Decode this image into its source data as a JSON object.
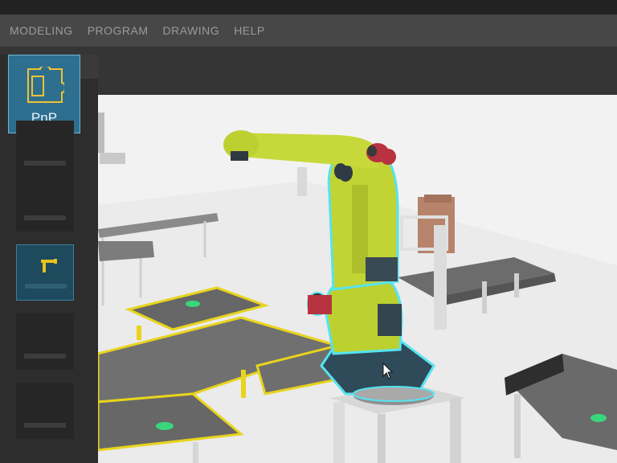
{
  "menu": {
    "items": [
      {
        "label": "MODELING"
      },
      {
        "label": "PROGRAM"
      },
      {
        "label": "DRAWING"
      },
      {
        "label": "HELP"
      }
    ]
  },
  "side_panel": {
    "selected_tile": {
      "label": "PnP",
      "icon": "puzzle-piece-icon"
    },
    "slots": [
      {
        "state": "empty"
      },
      {
        "state": "empty"
      },
      {
        "state": "active",
        "icon": "robot-arm-icon"
      },
      {
        "state": "empty"
      },
      {
        "state": "empty"
      }
    ]
  },
  "colors": {
    "accent": "#2e6f8f",
    "robot": "#c2d433",
    "selection_glow": "#56e3f0",
    "conveyor_frame": "#e8d41c"
  }
}
